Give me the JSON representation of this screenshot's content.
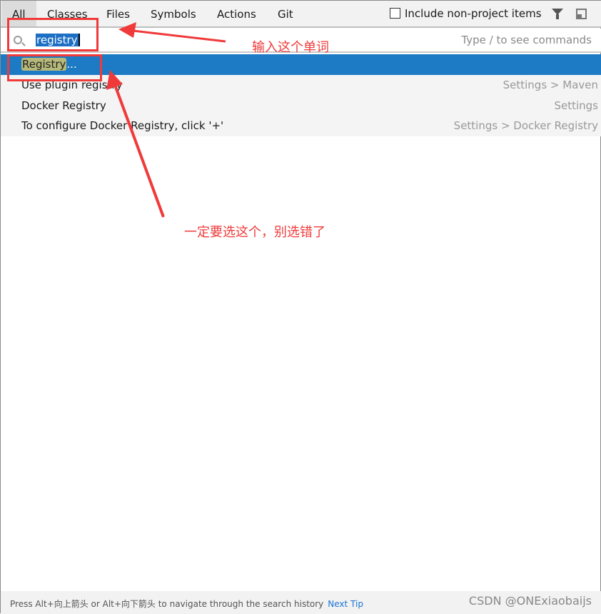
{
  "tabs": [
    {
      "label": "All",
      "active": true
    },
    {
      "label": "Classes"
    },
    {
      "label": "Files"
    },
    {
      "label": "Symbols"
    },
    {
      "label": "Actions"
    },
    {
      "label": "Git"
    }
  ],
  "include_non_project": {
    "label": "Include non-project items",
    "checked": false
  },
  "icons": [
    "filter-icon",
    "pin-window-icon",
    "search-icon"
  ],
  "search": {
    "value": "registry",
    "hint": "Type / to see commands"
  },
  "results": [
    {
      "match": "Registry",
      "suffix": "...",
      "location": "",
      "selected": true
    },
    {
      "label": "Use plugin registry",
      "location": "Settings > Maven"
    },
    {
      "label": "Docker Registry",
      "location": "Settings"
    },
    {
      "label": "To configure Docker Registry, click '+'",
      "location": "Settings > Docker Registry"
    }
  ],
  "footer": {
    "tip": "Press Alt+向上箭头 or Alt+向下箭头 to navigate through the search history",
    "next_tip": "Next Tip",
    "watermark": "CSDN @ONExiaobaijs"
  },
  "annotations": {
    "input_note": "输入这个单词",
    "select_note": "一定要选这个，别选错了",
    "color": "#f03a3a"
  },
  "colors": {
    "selection": "#1c7bc4",
    "match_highlight": "#b6b97a"
  }
}
